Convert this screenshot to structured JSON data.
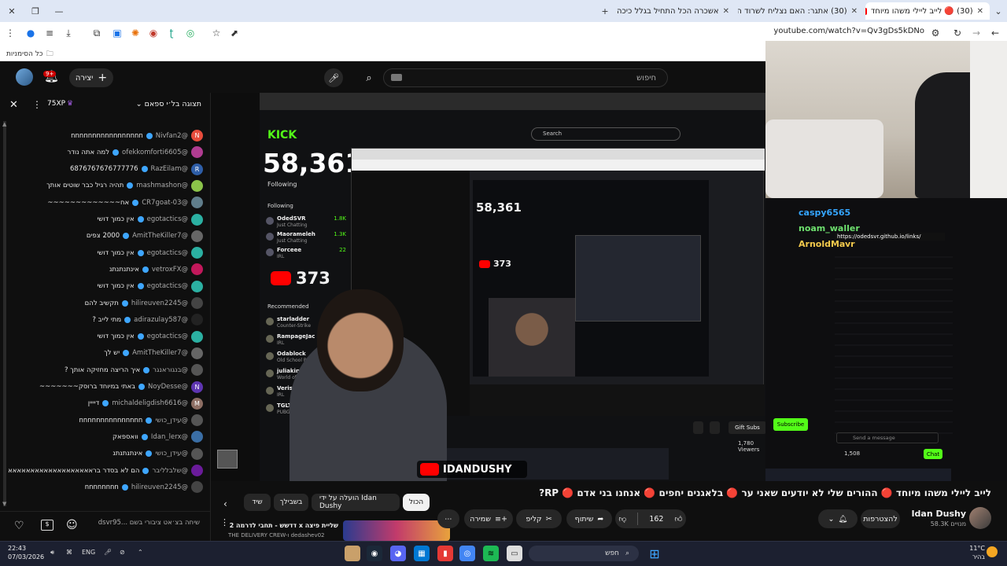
{
  "browser": {
    "tabs": [
      {
        "label": "(30) 🔴 לייב ליילי משהו מיוחד",
        "active": true
      },
      {
        "label": "(30) אתגר: האם נצליח לשרוד ה"
      },
      {
        "label": "אשכרה הכל התחיל בגלל כיכה"
      }
    ],
    "url": "youtube.com/watch?v=Qv3gDs5kDNo",
    "bookmarks_label": "כל הסימניות"
  },
  "header": {
    "search_placeholder": "חיפוש",
    "create_label": "יצירה",
    "notifications_badge": "9+"
  },
  "chat": {
    "mode_label": "תצוגה בל׳י ספאם",
    "xp_badge": "75XP",
    "input_placeholder": "שיחה בצ׳אט ציבורי בשם ...dsvr95",
    "messages": [
      {
        "author": "@Nivfan2",
        "text": "nnnnnnnnnnnnnnnnn",
        "initial": "N",
        "color": "#e74c3c"
      },
      {
        "author": "@ofekkomforti6605",
        "text": "למה אתה נודר",
        "initial": "",
        "color": "#b03c91"
      },
      {
        "author": "@RazEilam",
        "text": "6876767676777776",
        "initial": "R",
        "color": "#2e5ea8"
      },
      {
        "author": "@mashmashon",
        "text": "תהיה רגיל כבר שוטים אותך",
        "initial": "",
        "color": "#8bc34a"
      },
      {
        "author": "@CR7goat-03",
        "text": "אח~~~~~~~~~~~~~",
        "initial": "",
        "color": "#607d8b"
      },
      {
        "author": "@egotactics",
        "text": "אין כמוך דושי",
        "initial": "",
        "color": "#2bb0a2"
      },
      {
        "author": "@AmitTheKiller7",
        "text": "2000 צפים",
        "initial": "",
        "color": "#666"
      },
      {
        "author": "@egotactics",
        "text": "אין כמוך דושי",
        "initial": "",
        "color": "#2bb0a2"
      },
      {
        "author": "@vetroxFX",
        "text": "אינתנתנתנ",
        "initial": "",
        "color": "#c2185b"
      },
      {
        "author": "@egotactics",
        "text": "אין כמוך דושי",
        "initial": "",
        "color": "#2bb0a2"
      },
      {
        "author": "@hilireuven2245",
        "text": "תקשיב להם",
        "initial": "",
        "color": "#444"
      },
      {
        "author": "@adirazulay587",
        "text": "מתי לייב ?",
        "initial": "",
        "color": "#222"
      },
      {
        "author": "@egotactics",
        "text": "אין כמוך דושי",
        "initial": "",
        "color": "#2bb0a2"
      },
      {
        "author": "@AmitTheKiller7",
        "text": "יש לך",
        "initial": "",
        "color": "#666"
      },
      {
        "author": "@בנגוראנגר",
        "text": "איך הריצה מחזיקה אותך ?",
        "initial": "",
        "color": "#555"
      },
      {
        "author": "@NoyDesse",
        "text": "באתי במיוחד ברוסק~~~~~~~",
        "initial": "N",
        "color": "#5e35b1"
      },
      {
        "author": "@michaldeligdish6616",
        "text": "דיייין",
        "initial": "M",
        "color": "#8d6e63"
      },
      {
        "author": "@עידן_כושי",
        "text": "nnnnnnnnnnnnnnn",
        "initial": "",
        "color": "#555"
      },
      {
        "author": "@Idan_lerx",
        "text": "וואספאק",
        "initial": "",
        "color": "#3a6ea5"
      },
      {
        "author": "@עידן_כושי",
        "text": "אינתנתנתנ",
        "initial": "",
        "color": "#555"
      },
      {
        "author": "@שלבלליבר",
        "text": "הם לא בסדר בראאאאאאאאאאאאאאאאאאאאא",
        "initial": "",
        "color": "#6a1b9a"
      },
      {
        "author": "@hilireuven2245",
        "text": "nnnnnnnn",
        "initial": "",
        "color": "#444"
      }
    ]
  },
  "video": {
    "viewer_count_big": "58,361",
    "viewer_count_small": "58,361",
    "yt_count": "373",
    "yt_count_small": "373",
    "channel_watermark": "IDANDUSHY",
    "kick_logo": "KICK",
    "search_label": "Search",
    "following_label": "Following",
    "recommended_label": "Recommended",
    "gift_subs": "Gift Subs",
    "subscribe": "Subscribe",
    "viewers": "1,780 Viewers",
    "chat_button": "Chat",
    "send_message": "Send a message",
    "kick_points": "1,508",
    "kick_following": [
      {
        "name": "OdedSVR",
        "sub": "Just Chatting",
        "count": "1.8K"
      },
      {
        "name": "Maorameleh",
        "sub": "Just Chatting",
        "count": "1.3K"
      },
      {
        "name": "Forceee",
        "sub": "IRL",
        "count": "22"
      }
    ],
    "kick_recommended": [
      {
        "name": "starladder",
        "sub": "Counter-Strike"
      },
      {
        "name": "RampageJac",
        "sub": "IRL"
      },
      {
        "name": "Odablock",
        "sub": "Old School R"
      },
      {
        "name": "juliakins",
        "sub": "World of W"
      },
      {
        "name": "VerisG",
        "sub": "IRL"
      },
      {
        "name": "TGLTN",
        "sub": "PUBG: Battl"
      }
    ],
    "right_chat": [
      {
        "name": "caspy6565",
        "color": "#35a6ff"
      },
      {
        "name": "noam_waller",
        "color": "#6ee06e"
      },
      {
        "name": "ArnoldMayr",
        "color": "#f2c94c"
      }
    ],
    "link": "https://odedsvr.github.io/links/"
  },
  "watch": {
    "title": "לייב ליילי משהו מיוחד 🔴 ההורים שלי לא יודעים שאני ער 🔴 בלאגנים יחפים 🔴 אנחנו בני אדם 🔴 RP?",
    "channel_name": "Idan Dushy",
    "subscribers": "58.3K מנויים",
    "join_label": "להצטרפות",
    "likes": "162",
    "share_label": "שיתוף",
    "clip_label": "קליפ",
    "save_label": "שמירה",
    "chips": [
      "הכול",
      "הועלה על ידי Idan Dushy",
      "בשבילך",
      "שיד"
    ],
    "next_video_title": "שליית פיצה x דדשש - תחבי לדרמה 2",
    "next_video_channel": "THE DELIVERY CREW-ו dedashev02"
  },
  "taskbar": {
    "time": "22:43",
    "date": "07/03/2026",
    "lang": "ENG",
    "search_label": "חפש",
    "weather_temp": "11°C",
    "weather_text": "בהיר"
  },
  "colors": {
    "youtube_red": "#ff0000",
    "kick_green": "#53fc18",
    "chat_blue": "#3ea6ff"
  }
}
